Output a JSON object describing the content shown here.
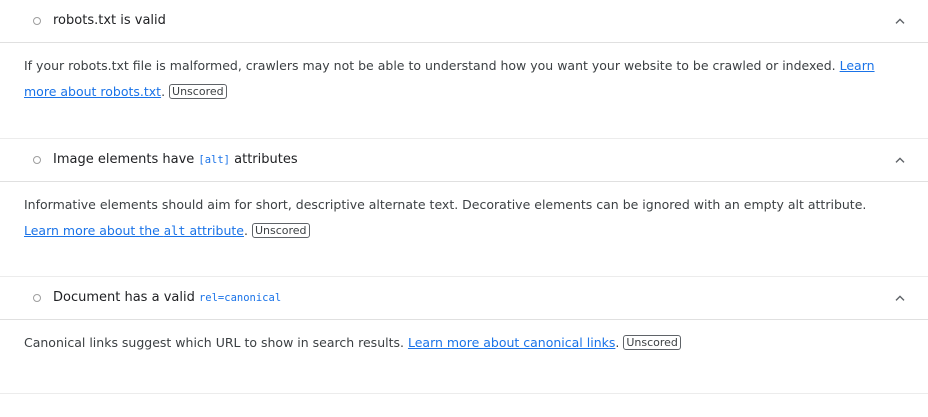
{
  "audits": [
    {
      "title": "robots.txt is valid",
      "description": "If your robots.txt file is malformed, crawlers may not be able to understand how you want your website to be crawled or indexed.",
      "link_text": "Learn more about robots.txt",
      "badge": "Unscored"
    },
    {
      "title_prefix": "Image elements have ",
      "title_code": "[alt]",
      "title_suffix": " attributes",
      "description": "Informative elements should aim for short, descriptive alternate text. Decorative elements can be ignored with an empty alt attribute.",
      "link_prefix": "Learn more about the ",
      "link_code": "alt",
      "link_suffix": " attribute",
      "badge": "Unscored"
    },
    {
      "title_prefix": "Document has a valid ",
      "title_code": "rel=canonical",
      "description": "Canonical links suggest which URL to show in search results.",
      "link_text": "Learn more about canonical links",
      "badge": "Unscored"
    }
  ],
  "icons": {
    "status": "circle-outline-icon",
    "toggle": "chevron-up-icon"
  }
}
